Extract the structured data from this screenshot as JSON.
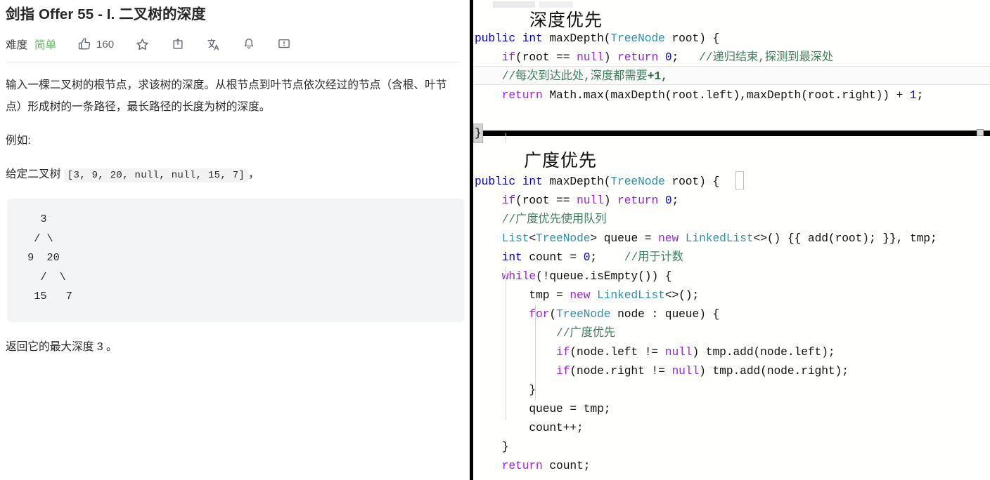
{
  "problem": {
    "title": "剑指 Offer 55 - I. 二叉树的深度",
    "meta": {
      "difficulty_label": "难度",
      "difficulty_value": "简单",
      "difficulty_color": "#5cb85c",
      "like_count": "160",
      "icons": [
        "thumbs-up-icon",
        "star-icon",
        "share-icon",
        "translate-icon",
        "bell-icon",
        "feedback-icon"
      ]
    },
    "description": {
      "paragraph1": "输入一棵二叉树的根节点，求该树的深度。从根节点到叶节点依次经过的节点（含根、叶节点）形成树的一条路径，最长路径的长度为树的深度。",
      "paragraph2": "例如:",
      "given_prefix": "给定二叉树",
      "given_code": "[3, 9, 20, null, null, 15, 7]",
      "given_suffix": "，",
      "tree_ascii": "   3\n  / \\\n 9  20\n   /  \\\n  15   7",
      "paragraph3": "返回它的最大深度 3 。"
    }
  },
  "editor": {
    "dfs": {
      "heading": "深度优先",
      "lines": [
        [
          {
            "t": "public int ",
            "c": "mod"
          },
          {
            "t": "maxDepth",
            "c": "plain"
          },
          {
            "t": "(",
            "c": "plain"
          },
          {
            "t": "TreeNode",
            "c": "type"
          },
          {
            "t": " root) {",
            "c": "plain"
          }
        ],
        [
          {
            "t": "    ",
            "c": "plain"
          },
          {
            "t": "if",
            "c": "kw"
          },
          {
            "t": "(root == ",
            "c": "plain"
          },
          {
            "t": "null",
            "c": "kw"
          },
          {
            "t": ") ",
            "c": "plain"
          },
          {
            "t": "return",
            "c": "kw"
          },
          {
            "t": " ",
            "c": "plain"
          },
          {
            "t": "0",
            "c": "num"
          },
          {
            "t": ";   ",
            "c": "plain"
          },
          {
            "t": "//递归结束,探测到最深处",
            "c": "cmt"
          }
        ],
        [
          {
            "t": "    ",
            "c": "plain"
          },
          {
            "t": "//每次到达此处,深度都需要",
            "c": "cmt"
          },
          {
            "t": "+1,",
            "c": "cmtb"
          }
        ],
        [
          {
            "t": "    ",
            "c": "plain"
          },
          {
            "t": "return",
            "c": "kw"
          },
          {
            "t": " Math.max(maxDepth(root.left),maxDepth(root.right)) + ",
            "c": "plain"
          },
          {
            "t": "1",
            "c": "num"
          },
          {
            "t": ";",
            "c": "plain"
          }
        ]
      ],
      "closing_brace": "}"
    },
    "bfs": {
      "heading": "广度优先",
      "lines": [
        [
          {
            "t": "public int ",
            "c": "mod"
          },
          {
            "t": "maxDepth",
            "c": "plain"
          },
          {
            "t": "(",
            "c": "plain"
          },
          {
            "t": "TreeNode",
            "c": "type"
          },
          {
            "t": " root) {",
            "c": "plain"
          }
        ],
        [
          {
            "t": "    ",
            "c": "plain"
          },
          {
            "t": "if",
            "c": "kw"
          },
          {
            "t": "(root == ",
            "c": "plain"
          },
          {
            "t": "null",
            "c": "kw"
          },
          {
            "t": ") ",
            "c": "plain"
          },
          {
            "t": "return",
            "c": "kw"
          },
          {
            "t": " ",
            "c": "plain"
          },
          {
            "t": "0",
            "c": "num"
          },
          {
            "t": ";",
            "c": "plain"
          }
        ],
        [
          {
            "t": "    ",
            "c": "plain"
          },
          {
            "t": "//广度优先使用队列",
            "c": "cmt"
          }
        ],
        [
          {
            "t": "    ",
            "c": "plain"
          },
          {
            "t": "List",
            "c": "type2"
          },
          {
            "t": "<",
            "c": "plain"
          },
          {
            "t": "TreeNode",
            "c": "type"
          },
          {
            "t": "> queue = ",
            "c": "plain"
          },
          {
            "t": "new",
            "c": "kw"
          },
          {
            "t": " ",
            "c": "plain"
          },
          {
            "t": "LinkedList",
            "c": "type2"
          },
          {
            "t": "<>() {{ add(root); }}, tmp;",
            "c": "plain"
          }
        ],
        [
          {
            "t": "    ",
            "c": "plain"
          },
          {
            "t": "int",
            "c": "mod"
          },
          {
            "t": " count = ",
            "c": "plain"
          },
          {
            "t": "0",
            "c": "num"
          },
          {
            "t": ";    ",
            "c": "plain"
          },
          {
            "t": "//用于计数",
            "c": "cmt"
          }
        ],
        [
          {
            "t": "    ",
            "c": "plain"
          },
          {
            "t": "while",
            "c": "kw"
          },
          {
            "t": "(!queue.isEmpty()) {",
            "c": "plain"
          }
        ],
        [
          {
            "t": "        tmp = ",
            "c": "plain"
          },
          {
            "t": "new",
            "c": "kw"
          },
          {
            "t": " ",
            "c": "plain"
          },
          {
            "t": "LinkedList",
            "c": "type2"
          },
          {
            "t": "<>();",
            "c": "plain"
          }
        ],
        [
          {
            "t": "        ",
            "c": "plain"
          },
          {
            "t": "for",
            "c": "kw"
          },
          {
            "t": "(",
            "c": "plain"
          },
          {
            "t": "TreeNode",
            "c": "type"
          },
          {
            "t": " node : queue) {",
            "c": "plain"
          }
        ],
        [
          {
            "t": "            ",
            "c": "plain"
          },
          {
            "t": "//广度优先",
            "c": "cmt"
          }
        ],
        [
          {
            "t": "            ",
            "c": "plain"
          },
          {
            "t": "if",
            "c": "kw"
          },
          {
            "t": "(node.left != ",
            "c": "plain"
          },
          {
            "t": "null",
            "c": "kw"
          },
          {
            "t": ") tmp.add(node.left);",
            "c": "plain"
          }
        ],
        [
          {
            "t": "            ",
            "c": "plain"
          },
          {
            "t": "if",
            "c": "kw"
          },
          {
            "t": "(node.right != ",
            "c": "plain"
          },
          {
            "t": "null",
            "c": "kw"
          },
          {
            "t": ") tmp.add(node.right);",
            "c": "plain"
          }
        ],
        [
          {
            "t": "        }",
            "c": "plain"
          }
        ],
        [
          {
            "t": "        queue = tmp;",
            "c": "plain"
          }
        ],
        [
          {
            "t": "        count++;",
            "c": "plain"
          }
        ],
        [
          {
            "t": "    }",
            "c": "plain"
          }
        ],
        [
          {
            "t": "    ",
            "c": "plain"
          },
          {
            "t": "return",
            "c": "kw"
          },
          {
            "t": " count;",
            "c": "plain"
          }
        ]
      ]
    }
  }
}
